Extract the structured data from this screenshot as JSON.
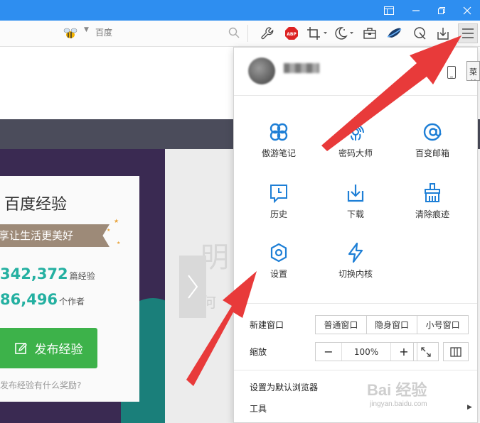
{
  "browser": {
    "search": {
      "placeholder": "百度"
    },
    "tooltip": "菜单",
    "accent_color": "#2e8ef0",
    "toolbar_icons": [
      "wrench-icon",
      "adblock-plus-icon",
      "screenshot-icon",
      "night-mode-icon",
      "toolbox-icon",
      "speed-icon",
      "feedback-icon",
      "download-icon",
      "menu-icon"
    ]
  },
  "page": {
    "card": {
      "title": "百度经验",
      "slogan": "享让生活更美好",
      "stat1_value": "342,372",
      "stat1_unit": "篇经验",
      "stat2_value": "86,496",
      "stat2_unit": "个作者",
      "publish_label": "发布经验",
      "reward_link": "发布经验有什么奖励?"
    },
    "right_big_char": "明",
    "right_small_char": "何"
  },
  "menu": {
    "grid": [
      {
        "label": "傲游笔记",
        "icon": "maxnote-icon"
      },
      {
        "label": "密码大师",
        "icon": "password-master-icon"
      },
      {
        "label": "百变邮箱",
        "icon": "mail-icon"
      },
      {
        "label": "历史",
        "icon": "history-icon"
      },
      {
        "label": "下载",
        "icon": "download-icon"
      },
      {
        "label": "清除痕迹",
        "icon": "clear-traces-icon"
      },
      {
        "label": "设置",
        "icon": "settings-gear-icon"
      },
      {
        "label": "切换内核",
        "icon": "switch-engine-icon"
      }
    ],
    "new_window": {
      "label": "新建窗口",
      "options": [
        "普通窗口",
        "隐身窗口",
        "小号窗口"
      ]
    },
    "zoom": {
      "label": "缩放",
      "minus": "−",
      "value": "100%",
      "plus": "+"
    },
    "set_default": "设置为默认浏览器",
    "tools": "工具"
  },
  "watermark": {
    "main": "Bai 经验",
    "sub": "jingyan.baidu.com"
  }
}
